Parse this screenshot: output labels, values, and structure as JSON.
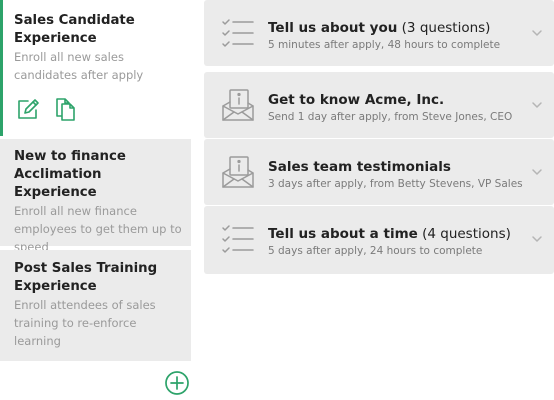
{
  "experiences": [
    {
      "title": "Sales Candidate Experience",
      "description": "Enroll all new sales candidates after apply",
      "active": true
    },
    {
      "title": "New to finance Acclimation Experience",
      "description": "Enroll all new finance employees to get them up to speed"
    },
    {
      "title": "Post Sales Training Experience",
      "description": "Enroll attendees of sales training to re-enforce learning"
    }
  ],
  "messages": [
    {
      "title_main": "Tell us about you",
      "title_suffix": " (3 questions)",
      "subtitle": "5 minutes after apply, 48 hours to complete",
      "icon": "checklist-icon"
    },
    {
      "title_main": "Get to know Acme, Inc.",
      "title_suffix": "",
      "subtitle": "Send 1 day after apply, from Steve Jones, CEO",
      "icon": "mail-info-icon"
    },
    {
      "title_main": "Sales team testimonials",
      "title_suffix": "",
      "subtitle": "3 days after apply, from Betty Stevens, VP Sales",
      "icon": "mail-info-icon"
    },
    {
      "title_main": "Tell us about a time",
      "title_suffix": " (4 questions)",
      "subtitle": "5 days after apply, 24 hours to complete",
      "icon": "checklist-icon"
    }
  ],
  "colors": {
    "accent": "#2da36a",
    "panel": "#ebebeb",
    "icon": "#9b9b9b"
  }
}
